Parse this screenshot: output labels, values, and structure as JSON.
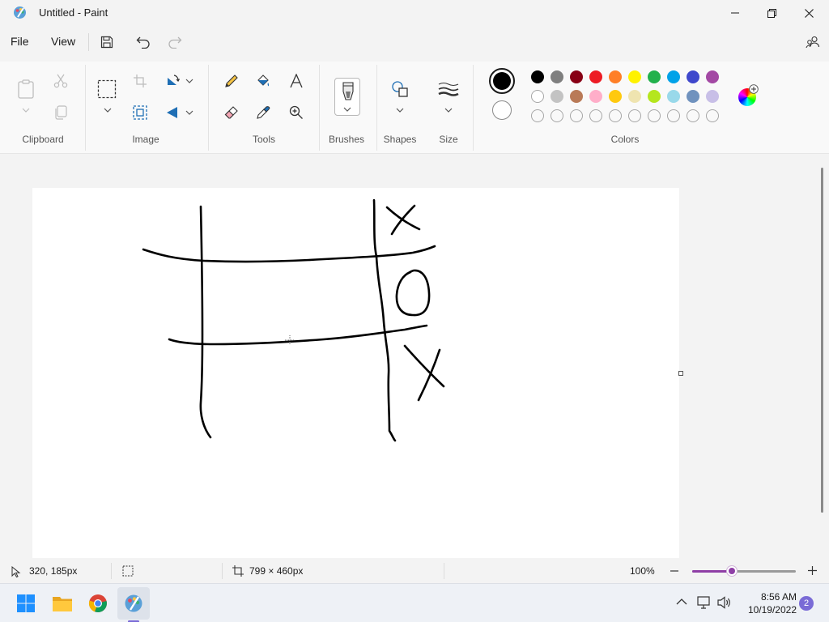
{
  "window": {
    "title": "Untitled - Paint"
  },
  "menu": {
    "file": "File",
    "view": "View"
  },
  "ribbon": {
    "groups": {
      "clipboard": "Clipboard",
      "image": "Image",
      "tools": "Tools",
      "brushes": "Brushes",
      "shapes": "Shapes",
      "size": "Size",
      "colors": "Colors"
    }
  },
  "colors": {
    "primary": "#000000",
    "secondary": "#ffffff",
    "palette_row1": [
      "#000000",
      "#7f7f7f",
      "#880015",
      "#ed1c24",
      "#ff7f27",
      "#fff200",
      "#22b14c",
      "#00a2e8",
      "#3f48cc",
      "#a349a4"
    ],
    "palette_row2": [
      "#ffffff",
      "#c3c3c3",
      "#b97a57",
      "#ffaec9",
      "#ffc90e",
      "#efe4b0",
      "#b5e61d",
      "#99d9ea",
      "#7092be",
      "#c8bfe7"
    ],
    "custom_slots": 10
  },
  "status": {
    "cursor_pos": "320, 185px",
    "canvas_size": "799 × 460px",
    "zoom": "100%",
    "zoom_level": 0.38
  },
  "taskbar": {
    "time": "8:56 AM",
    "date": "10/19/2022",
    "notifications": "2"
  }
}
